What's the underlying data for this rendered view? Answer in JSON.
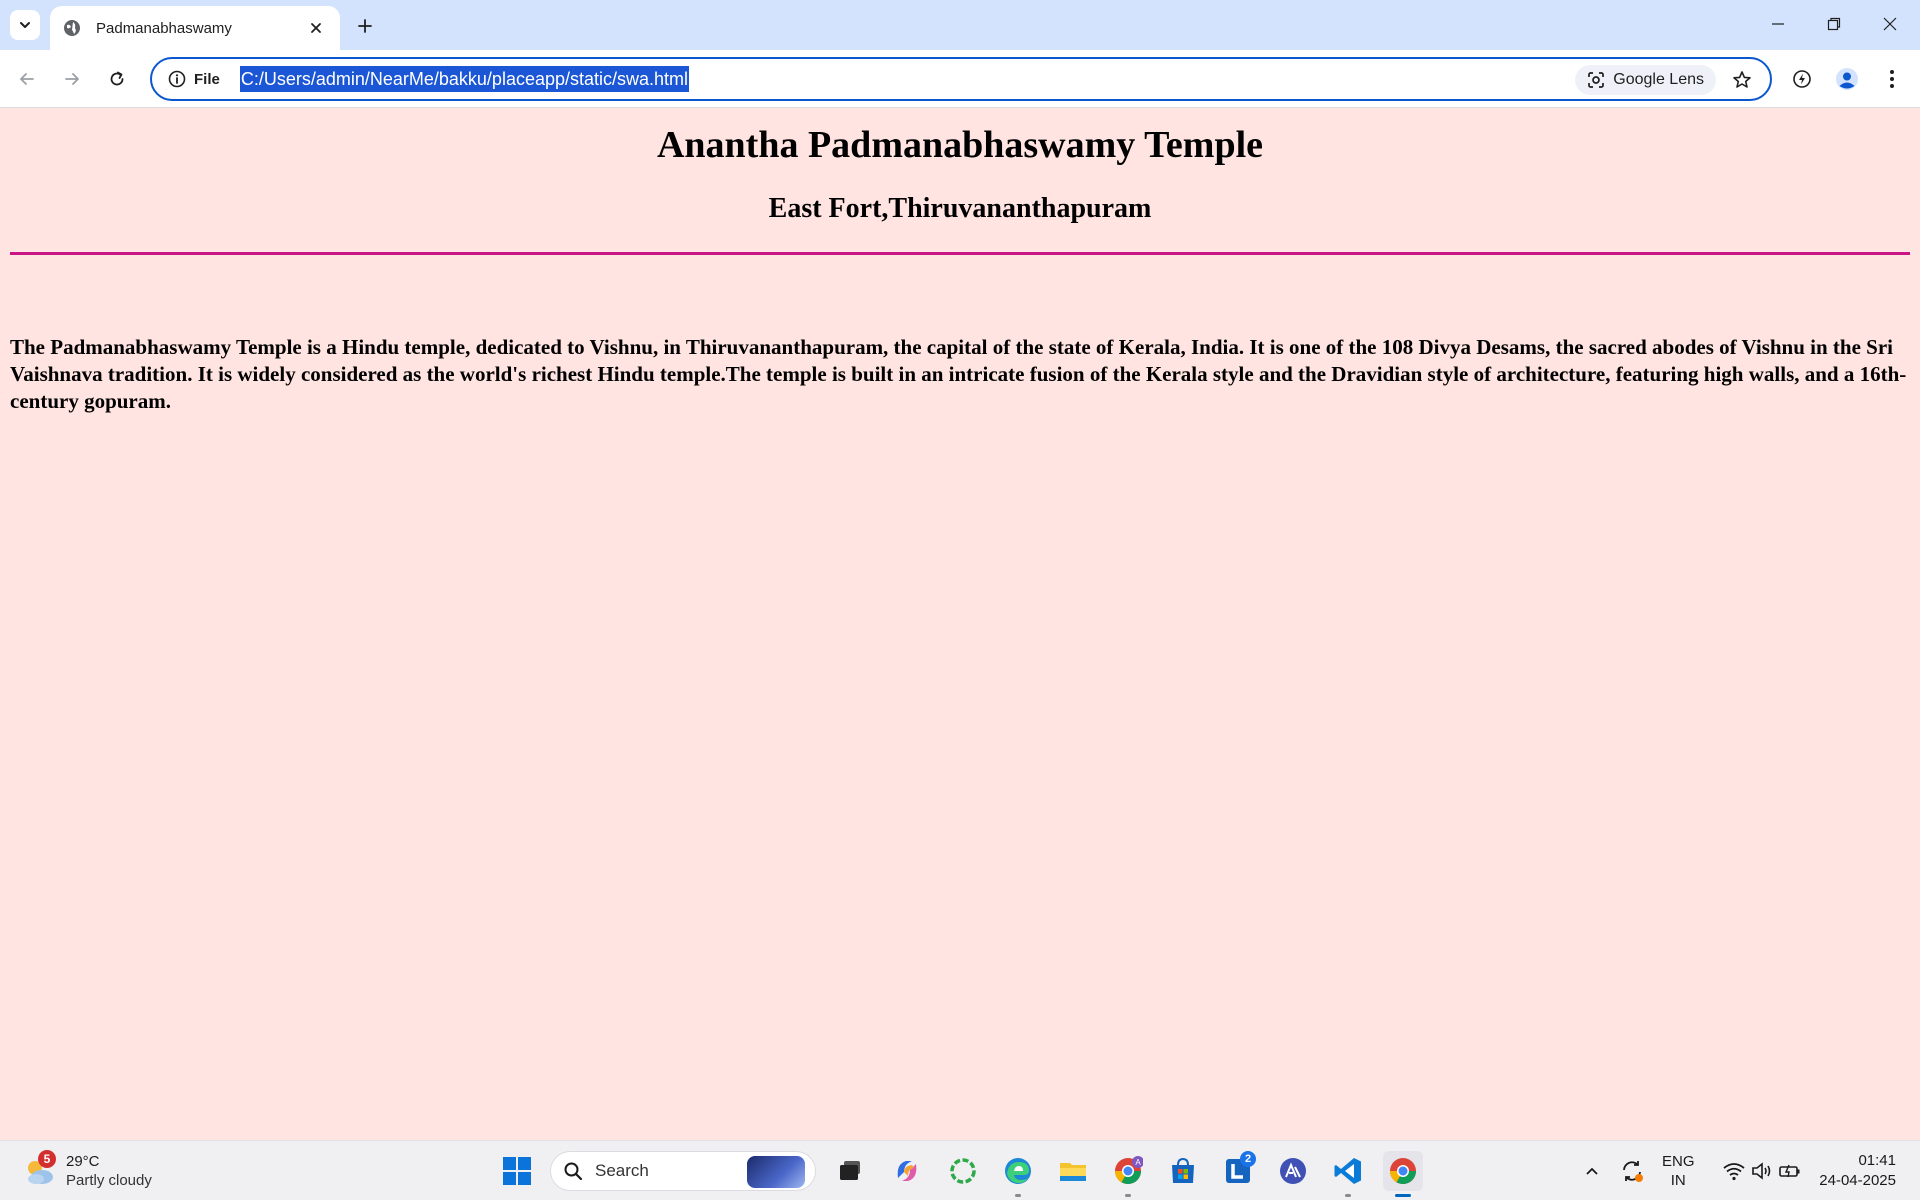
{
  "browser": {
    "tab_title": "Padmanabhaswamy",
    "site_chip_label": "File",
    "url": "C:/Users/admin/NearMe/bakku/placeapp/static/swa.html",
    "lens_label": "Google Lens"
  },
  "page": {
    "title": "Anantha Padmanabhaswamy Temple",
    "subtitle": "East Fort,Thiruvananthapuram",
    "description": "The Padmanabhaswamy Temple is a Hindu temple, dedicated to Vishnu, in Thiruvananthapuram, the capital of the state of Kerala, India. It is one of the 108 Divya Desams, the sacred abodes of Vishnu in the Sri Vaishnava tradition. It is widely considered as the world's richest Hindu temple.The temple is built in an intricate fusion of the Kerala style and the Dravidian style of architecture, featuring high walls, and a 16th-century gopuram.",
    "background_color": "#ffe4e1",
    "divider_color": "#c71585"
  },
  "taskbar": {
    "weather_badge": "5",
    "weather_temp": "29°C",
    "weather_condition": "Partly cloudy",
    "search_label": "Search",
    "todo_badge": "2",
    "language_line1": "ENG",
    "language_line2": "IN",
    "time": "01:41",
    "date": "24-04-2025"
  },
  "icons": {
    "tab_search": "chevron-down-icon",
    "favicon": "globe-icon",
    "tab_close": "close-icon",
    "new_tab": "plus-icon",
    "back": "arrow-left-icon",
    "forward": "arrow-right-icon",
    "reload": "reload-icon",
    "site_info": "info-icon",
    "lens": "camera-lens-icon",
    "bookmark": "star-icon",
    "performance": "lightning-icon",
    "profile": "person-icon",
    "menu": "kebab-menu-icon"
  }
}
